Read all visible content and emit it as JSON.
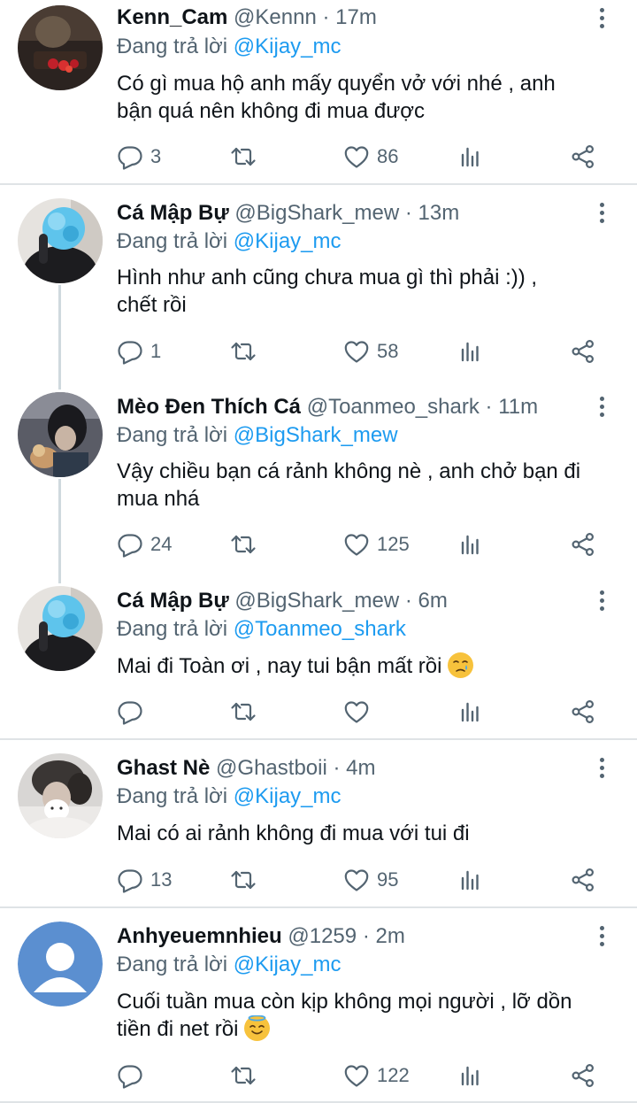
{
  "tweets": [
    {
      "name": "Kenn_Cam",
      "handle": "@Kennn",
      "dot": "·",
      "time": "17m",
      "reply_prefix": "Đang trả lời",
      "reply_to": "@Kijay_mc",
      "line1": "Có gì mua hộ anh mấy quyển vở với nhé , anh",
      "line2": "bận quá nên không đi mua được",
      "replies": "3",
      "retweets": "",
      "likes": "86"
    },
    {
      "name": "Cá Mập Bự",
      "handle": "@BigShark_mew",
      "dot": "·",
      "time": "13m",
      "reply_prefix": "Đang trả lời",
      "reply_to": "@Kijay_mc",
      "line1": "Hình như anh cũng chưa mua gì thì phải :)) ,",
      "line2": "chết rồi",
      "replies": "1",
      "retweets": "",
      "likes": "58"
    },
    {
      "name": "Mèo Đen Thích Cá",
      "handle": "@Toanmeo_shark",
      "dot": "·",
      "time": "11m",
      "reply_prefix": "Đang trả lời",
      "reply_to": "@BigShark_mew",
      "line1": "Vậy chiều bạn cá rảnh không nè , anh chở bạn đi",
      "line2": "mua nhá",
      "replies": "24",
      "retweets": "",
      "likes": "125"
    },
    {
      "name": "Cá Mập Bự",
      "handle": "@BigShark_mew",
      "dot": "·",
      "time": "6m",
      "reply_prefix": "Đang trả lời",
      "reply_to": "@Toanmeo_shark",
      "line1": "Mai đi Toàn ơi , nay tui bận mất rồi",
      "emoji1": "crying-face-emoji",
      "replies": "",
      "retweets": "",
      "likes": ""
    },
    {
      "name": "Ghast Nè",
      "handle": "@Ghastboii",
      "dot": "·",
      "time": "4m",
      "reply_prefix": "Đang trả lời",
      "reply_to": "@Kijay_mc",
      "line1": "Mai có ai rảnh không đi mua với tui đi",
      "replies": "13",
      "retweets": "",
      "likes": "95"
    },
    {
      "name": "Anhyeuemnhieu",
      "handle": "@1259",
      "dot": "·",
      "time": "2m",
      "reply_prefix": "Đang trả lời",
      "reply_to": "@Kijay_mc",
      "line1": "Cuối tuần mua còn kịp không mọi người , lỡ dồn",
      "line2": "tiền đi net rồi",
      "emoji2": "smiling-face-with-halo-emoji",
      "replies": "",
      "retweets": "",
      "likes": "122"
    }
  ],
  "icons": {
    "reply": "reply-icon",
    "retweet": "retweet-icon",
    "like": "heart-icon",
    "stats": "analytics-icon",
    "share": "share-icon",
    "more": "more-vertical-icon"
  },
  "colors": {
    "text": "#0f1419",
    "secondary": "#536471",
    "link": "#1d9bf0",
    "divider": "#dfe3e6",
    "thread_line": "#cfd9de"
  }
}
